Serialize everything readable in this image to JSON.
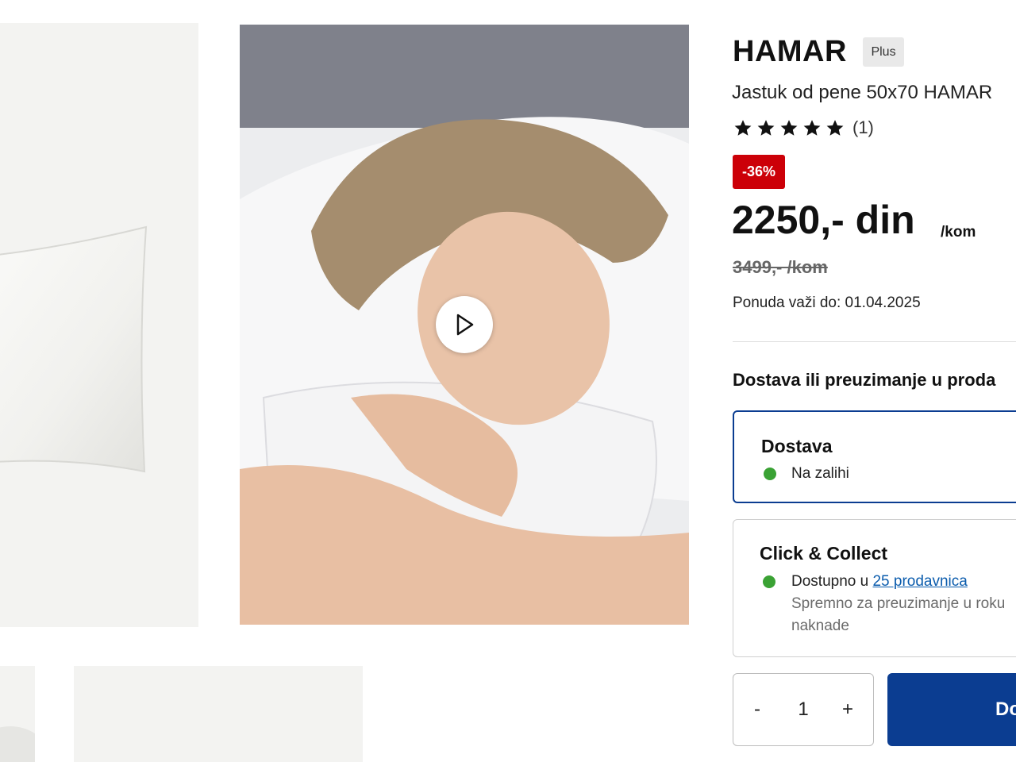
{
  "product": {
    "brand": "HAMAR",
    "badge": "Plus",
    "subtitle": "Jastuk od pene 50x70 HAMAR",
    "rating": {
      "stars": 5,
      "count_label": "(1)"
    },
    "discount_label": "-36%",
    "price": "2250,- din",
    "price_unit": "/kom",
    "old_price": "3499,- /kom",
    "offer_valid": "Ponuda važi do: 01.04.2025"
  },
  "availability": {
    "heading": "Dostava ili preuzimanje u proda",
    "delivery": {
      "title": "Dostava",
      "status": "Na zalihi"
    },
    "collect": {
      "title": "Click & Collect",
      "available_prefix": "Dostupno u",
      "stores_link": "25 prodavnica",
      "ready_line1": "Spremno za preuzimanje u roku",
      "ready_line2": "naknade"
    }
  },
  "purchase": {
    "minus_label": "-",
    "quantity": "1",
    "plus_label": "+",
    "add_button": "Do"
  },
  "media": {
    "play_icon": "play-icon"
  },
  "colors": {
    "accent_blue": "#0b3d91",
    "discount_red": "#cc0008",
    "stock_green": "#3aa234",
    "link_blue": "#0b5cad"
  }
}
